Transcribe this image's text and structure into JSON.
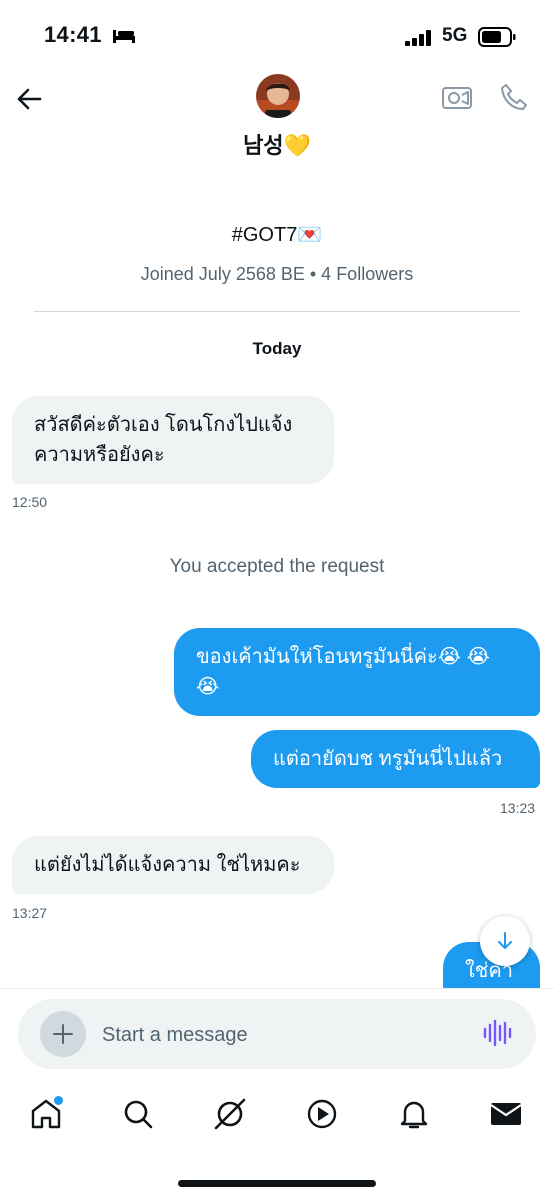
{
  "status_bar": {
    "time": "14:41",
    "network": "5G"
  },
  "header": {
    "display_name": "남성💛",
    "bio": "#GOT7💌",
    "joined": "Joined July 2568 BE • 4 Followers"
  },
  "conversation": {
    "day_label": "Today",
    "m1": {
      "text": "สวัสดีค่ะตัวเอง โดนโกงไปแจ้งความหรือยังคะ",
      "time": "12:50"
    },
    "system": "You accepted the request",
    "m2": {
      "text": "ของเค้ามันให่โอนทรูมันนี่ค่ะ😭 😭 😭"
    },
    "m3": {
      "text": "แต่อายัดบช ทรูมันนี่ไปแล้ว",
      "time": "13:23"
    },
    "m4": {
      "text": "แต่ยังไม่ได้แจ้งความ ใช่ไหมคะ",
      "time": "13:27"
    },
    "m5": {
      "text": "ใช่ค่า"
    }
  },
  "composer": {
    "placeholder": "Start a message"
  },
  "nav": [
    "home-icon",
    "search-icon",
    "grok-icon",
    "video-icon",
    "notifications-icon",
    "messages-icon"
  ],
  "colors": {
    "accent": "#1d9bf0",
    "received_bubble": "#eff3f4",
    "secondary_text": "#536471"
  }
}
